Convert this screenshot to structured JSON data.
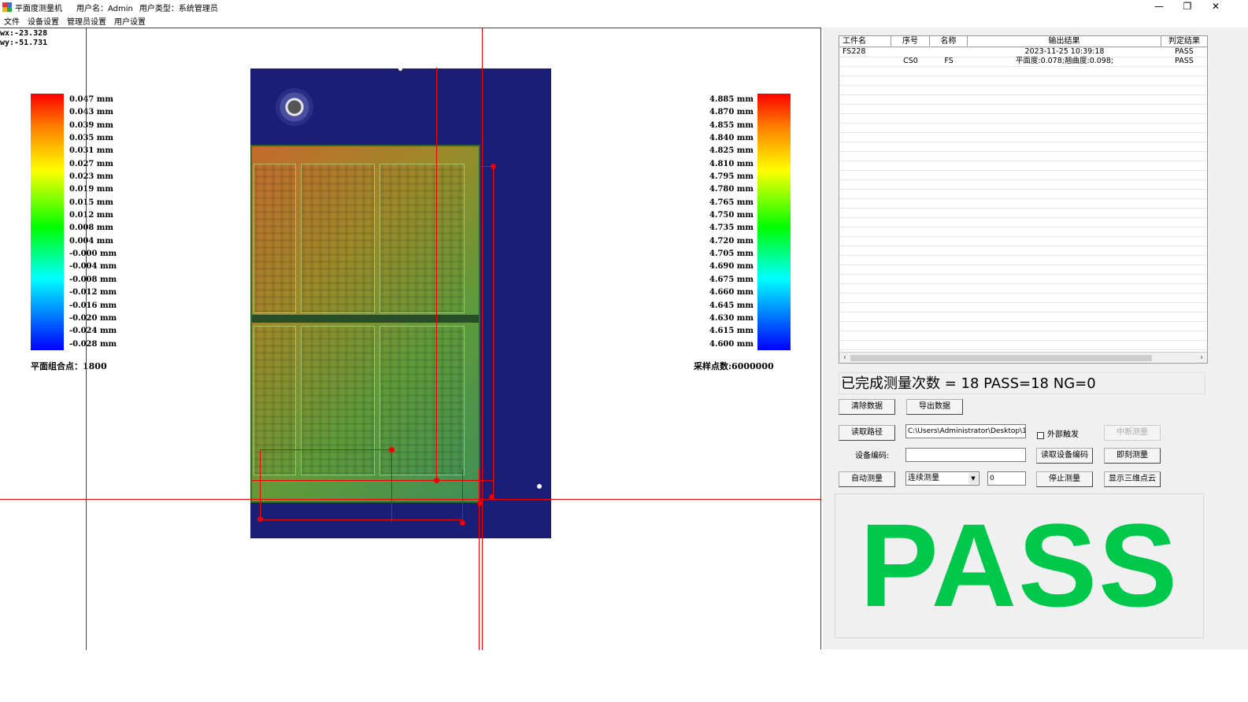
{
  "titlebar": {
    "app_title": "平面度测量机",
    "user_label": "用户名：Admin",
    "user_type_label": "用户类型：系统管理员",
    "minimize_glyph": "—",
    "restore_glyph": "❐",
    "close_glyph": "✕"
  },
  "menu": [
    "文件",
    "设备设置",
    "管理员设置",
    "用户设置"
  ],
  "coords": {
    "wx": "wx:-23.328",
    "wy": "wy:-51.731"
  },
  "left_scale": {
    "labels": [
      "0.047 mm",
      "0.043 mm",
      "0.039 mm",
      "0.035 mm",
      "0.031 mm",
      "0.027 mm",
      "0.023 mm",
      "0.019 mm",
      "0.015 mm",
      "0.012 mm",
      "0.008 mm",
      "0.004 mm",
      "-0.000 mm",
      "-0.004 mm",
      "-0.008 mm",
      "-0.012 mm",
      "-0.016 mm",
      "-0.020 mm",
      "-0.024 mm",
      "-0.028 mm"
    ],
    "note": "平面组合点：1800"
  },
  "right_scale": {
    "labels": [
      "4.885 mm",
      "4.870 mm",
      "4.855 mm",
      "4.840 mm",
      "4.825 mm",
      "4.810 mm",
      "4.795 mm",
      "4.780 mm",
      "4.765 mm",
      "4.750 mm",
      "4.735 mm",
      "4.720 mm",
      "4.705 mm",
      "4.690 mm",
      "4.675 mm",
      "4.660 mm",
      "4.645 mm",
      "4.630 mm",
      "4.615 mm",
      "4.600 mm"
    ],
    "note": "采样点数:6000000"
  },
  "table": {
    "columns": [
      "工件名",
      "序号",
      "名称",
      "输出结果",
      "判定结果"
    ],
    "rows": [
      {
        "workpiece": "FS228",
        "index": "",
        "name": "",
        "output": "2023-11-25 10:39:18",
        "judge": "PASS"
      },
      {
        "workpiece": "",
        "index": "CS0",
        "name": "FS",
        "output": "平面度:0.078;翘曲度:0.098;",
        "judge": "PASS"
      }
    ],
    "scroll_left": "‹",
    "scroll_right": "›"
  },
  "summary": "已完成测量次数 = 18  PASS=18  NG=0",
  "controls": {
    "clear_data": "清除数据",
    "export_data": "导出数据",
    "read_path": "读取路径",
    "path_value": "C:\\Users\\Administrator\\Desktop\\1",
    "external_trigger": "外部触发",
    "interrupt_measure": "中断测量",
    "device_code_label": "设备编码:",
    "device_code_value": "",
    "read_device_code": "读取设备编码",
    "instant_measure": "即刻测量",
    "auto_measure": "自动测量",
    "mode_value": "连续测量",
    "count_value": "0",
    "stop_measure": "停止测量",
    "show_3d_cloud": "显示三维点云"
  },
  "result": {
    "text": "PASS",
    "color": "#00c84a"
  }
}
